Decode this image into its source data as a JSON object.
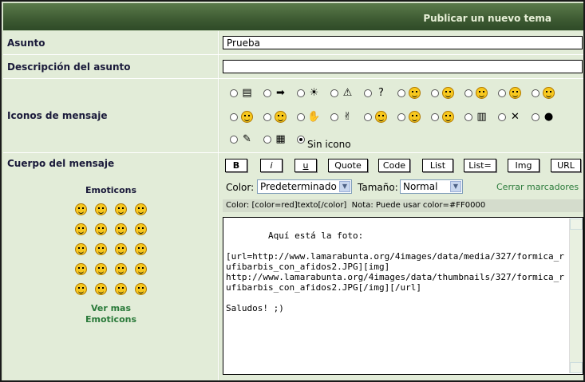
{
  "header": {
    "title": "Publicar un nuevo tema"
  },
  "asunto": {
    "label": "Asunto",
    "value": "Prueba"
  },
  "descripcion": {
    "label": "Descripción del asunto",
    "value": ""
  },
  "iconos": {
    "label": "Iconos de mensaje",
    "icons_row1": [
      "note-icon",
      "arrow-icon",
      "lightbulb-icon",
      "warning-icon",
      "question-icon",
      "cool-icon",
      "smile-icon",
      "sad-icon",
      "angry-icon",
      "grin-icon"
    ],
    "icons_row2": [
      "surprised-icon",
      "happy-icon",
      "thumbs-down-icon",
      "thumbs-up-icon",
      "tongue-icon",
      "wink-icon",
      "laugh-icon",
      "book-icon",
      "swords-icon",
      "bomb-icon"
    ],
    "icons_row3": [
      "tools-icon",
      "keyboard-icon"
    ],
    "sin_icono": "Sin icono"
  },
  "cuerpo": {
    "label": "Cuerpo del mensaje",
    "emoticons_title": "Emoticons",
    "ver_mas_1": "Ver mas",
    "ver_mas_2": "Emoticons",
    "buttons": [
      "B",
      "i",
      "u",
      "Quote",
      "Code",
      "List",
      "List=",
      "Img",
      "URL"
    ],
    "color_label": "Color:",
    "color_value": "Predeterminado",
    "size_label": "Tamaño:",
    "size_value": "Normal",
    "cerrar": "Cerrar marcadores",
    "hint": "Color: [color=red]texto[/color]  Nota: Puede usar color=#FF0000",
    "message": "Aquí está la foto:\n\n[url=http://www.lamarabunta.org/4images/data/media/327/formica_rufibarbis_con_afidos2.JPG][img]\nhttp://www.lamarabunta.org/4images/data/thumbnails/327/formica_rufibarbis_con_afidos2.JPG[/img][/url]\n\nSaludos! ;)"
  }
}
